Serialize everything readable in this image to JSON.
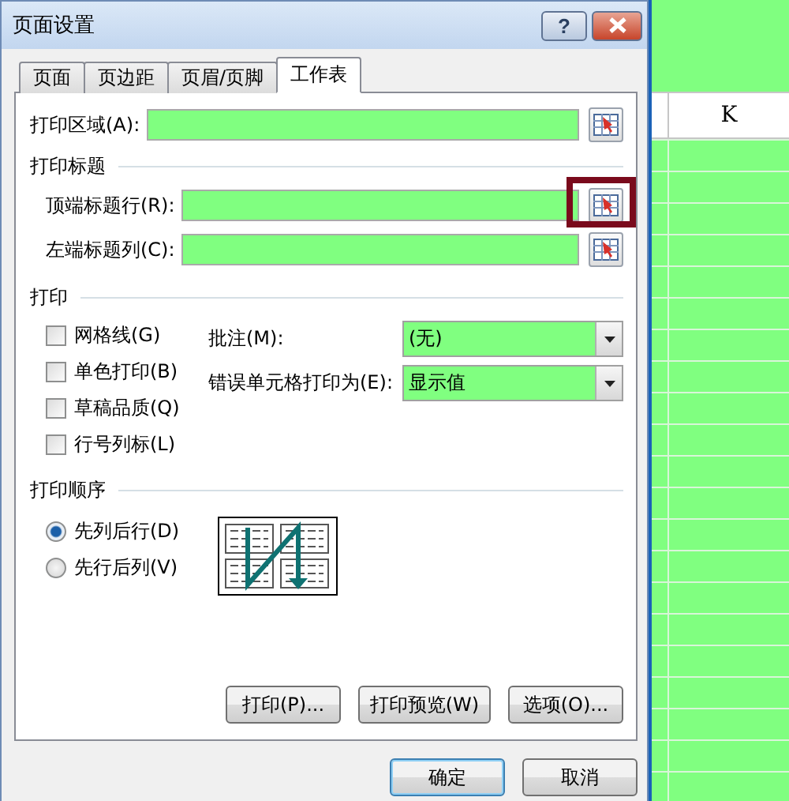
{
  "window": {
    "title": "页面设置",
    "help": "?"
  },
  "tabs": [
    {
      "label": "页面",
      "selected": false
    },
    {
      "label": "页边距",
      "selected": false
    },
    {
      "label": "页眉/页脚",
      "selected": false
    },
    {
      "label": "工作表",
      "selected": true
    }
  ],
  "print_area": {
    "label": "打印区域(A):"
  },
  "print_titles": {
    "heading": "打印标题",
    "rows": [
      {
        "label": "顶端标题行(R):",
        "highlighted": true
      },
      {
        "label": "左端标题列(C):",
        "highlighted": false
      }
    ]
  },
  "print": {
    "heading": "打印",
    "checkboxes": [
      {
        "label": "网格线(G)",
        "checked": false
      },
      {
        "label": "单色打印(B)",
        "checked": false
      },
      {
        "label": "草稿品质(Q)",
        "checked": false
      },
      {
        "label": "行号列标(L)",
        "checked": false
      }
    ],
    "dropdowns": [
      {
        "label": "批注(M):",
        "value": "(无)"
      },
      {
        "label": "错误单元格打印为(E):",
        "value": "显示值"
      }
    ]
  },
  "print_order": {
    "heading": "打印顺序",
    "options": [
      {
        "label": "先列后行(D)",
        "selected": true
      },
      {
        "label": "先行后列(V)",
        "selected": false
      }
    ]
  },
  "panel_buttons": [
    "打印(P)...",
    "打印预览(W)",
    "选项(O)..."
  ],
  "dialog_buttons": [
    {
      "label": "确定",
      "default": true
    },
    {
      "label": "取消",
      "default": false
    }
  ],
  "spreadsheet": {
    "column_header": "K"
  }
}
